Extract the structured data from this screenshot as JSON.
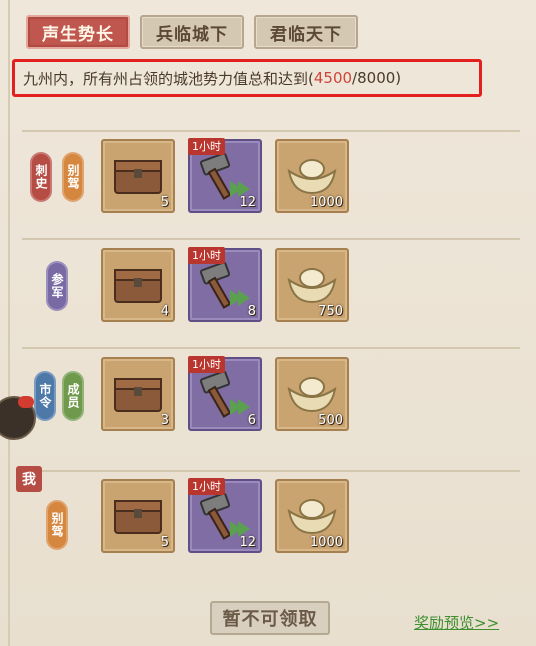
{
  "tabs": [
    {
      "label": "声生势长",
      "active": true
    },
    {
      "label": "兵临城下",
      "active": false
    },
    {
      "label": "君临天下",
      "active": false
    }
  ],
  "objective": {
    "prefix": "九州内，所有州占领的城池势力值总和达到(",
    "current": "4500",
    "separator": "/",
    "target": "8000",
    "suffix": ")"
  },
  "tiers": [
    {
      "ranks": [
        {
          "label": "刺史",
          "color": "red"
        },
        {
          "label": "别驾",
          "color": "orange"
        }
      ],
      "rewards": [
        {
          "icon": "treasure-chest-icon",
          "qty": "5",
          "timer": ""
        },
        {
          "icon": "hammer-icon",
          "qty": "12",
          "timer": "1小时"
        },
        {
          "icon": "gold-ingot-icon",
          "qty": "1000",
          "timer": ""
        }
      ]
    },
    {
      "ranks": [
        {
          "label": "参军",
          "color": "purple"
        }
      ],
      "rewards": [
        {
          "icon": "treasure-chest-icon",
          "qty": "4",
          "timer": ""
        },
        {
          "icon": "hammer-icon",
          "qty": "8",
          "timer": "1小时"
        },
        {
          "icon": "gold-ingot-icon",
          "qty": "750",
          "timer": ""
        }
      ]
    },
    {
      "ranks": [
        {
          "label": "市令",
          "color": "blue"
        },
        {
          "label": "成员",
          "color": "green"
        }
      ],
      "rewards": [
        {
          "icon": "treasure-chest-icon",
          "qty": "3",
          "timer": ""
        },
        {
          "icon": "hammer-icon",
          "qty": "6",
          "timer": "1小时"
        },
        {
          "icon": "gold-ingot-icon",
          "qty": "500",
          "timer": ""
        }
      ]
    },
    {
      "ranks": [
        {
          "label": "别驾",
          "color": "orange"
        }
      ],
      "rewards": [
        {
          "icon": "treasure-chest-icon",
          "qty": "5",
          "timer": ""
        },
        {
          "icon": "hammer-icon",
          "qty": "12",
          "timer": "1小时"
        },
        {
          "icon": "gold-ingot-icon",
          "qty": "1000",
          "timer": ""
        }
      ]
    }
  ],
  "me_badge": "我",
  "claim_button": "暂不可领取",
  "preview_link": "奖励预览>>",
  "colors": {
    "accent_red": "#c0574f",
    "highlight_border": "#e22020",
    "progress_value": "#d0453a",
    "link_green": "#3e8f2e"
  }
}
